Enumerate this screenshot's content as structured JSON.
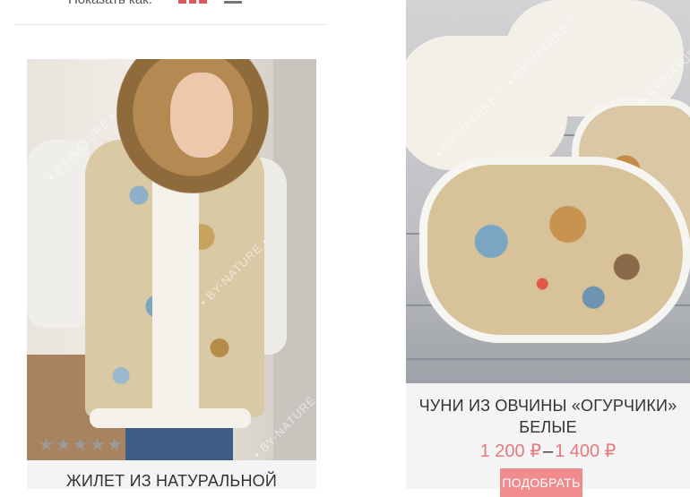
{
  "toolbar": {
    "show_as_label": "Показать как:"
  },
  "watermark": "• BY-NATURE •",
  "products": [
    {
      "title": "ЖИЛЕТ ИЗ НАТУРАЛЬНОЙ",
      "rating": 0,
      "rating_max": 5
    },
    {
      "title": "ЧУНИ ИЗ ОВЧИНЫ «ОГУРЧИКИ» БЕЛЫЕ",
      "price_from": "1 200 ₽",
      "price_sep": "–",
      "price_to": "1 400 ₽",
      "button_label": "ПОДОБРАТЬ"
    }
  ],
  "colors": {
    "accent": "#e0565c",
    "price": "#e47a7c",
    "button": "#f08c8e"
  }
}
